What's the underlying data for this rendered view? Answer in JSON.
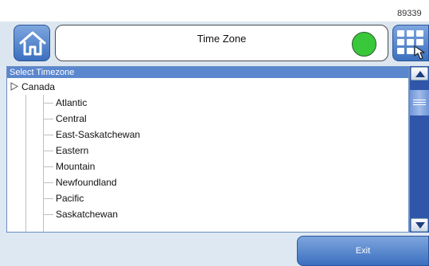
{
  "corner_id": "89339",
  "header": {
    "home_icon": "home-icon",
    "title": "Time Zone",
    "status_color": "#39c83a",
    "menu_icon": "grid-menu-hand-icon"
  },
  "list": {
    "header": "Select Timezone",
    "root": {
      "label": "Canada",
      "icon": "expand-triangle-icon"
    },
    "items": [
      "Atlantic",
      "Central",
      "East-Saskatchewan",
      "Eastern",
      "Mountain",
      "Newfoundland",
      "Pacific",
      "Saskatchewan"
    ]
  },
  "scroll": {
    "up_icon": "arrow-up-icon",
    "down_icon": "arrow-down-icon"
  },
  "footer": {
    "exit_label": "Exit"
  },
  "colors": {
    "accent": "#3b6fbf",
    "list_header": "#5b87cf",
    "scrollbar": "#2f56a8"
  }
}
